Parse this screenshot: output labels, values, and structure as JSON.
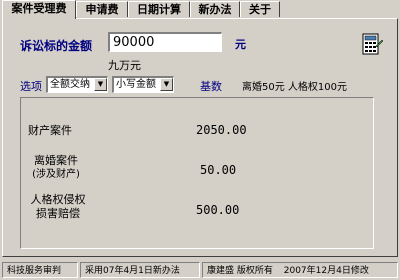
{
  "tabs": [
    {
      "label": "案件受理费",
      "active": true
    },
    {
      "label": "申请费",
      "active": false
    },
    {
      "label": "日期计算",
      "active": false
    },
    {
      "label": "新办法",
      "active": false
    },
    {
      "label": "关于",
      "active": false
    }
  ],
  "form": {
    "amount_label": "诉讼标的金额",
    "amount_value": "90000",
    "unit": "元",
    "amount_chinese": "九万元",
    "options_label": "选项",
    "option1": "全额交纳",
    "option2": "小写金额",
    "base_label": "基数",
    "base_text": "离婚50元 人格权100元"
  },
  "results": [
    {
      "label": "财产案件",
      "value": "2050.00"
    },
    {
      "label": "离婚案件\n(涉及财产)",
      "value": "50.00"
    },
    {
      "label": "人格权侵权\n损害赔偿",
      "value": "500.00"
    }
  ],
  "status": {
    "left": "科技服务审判",
    "mid": "采用07年4月1日新办法",
    "author": "康建盛 版权所有",
    "date": "2007年12月4日修改"
  },
  "icon": "calculator-icon"
}
